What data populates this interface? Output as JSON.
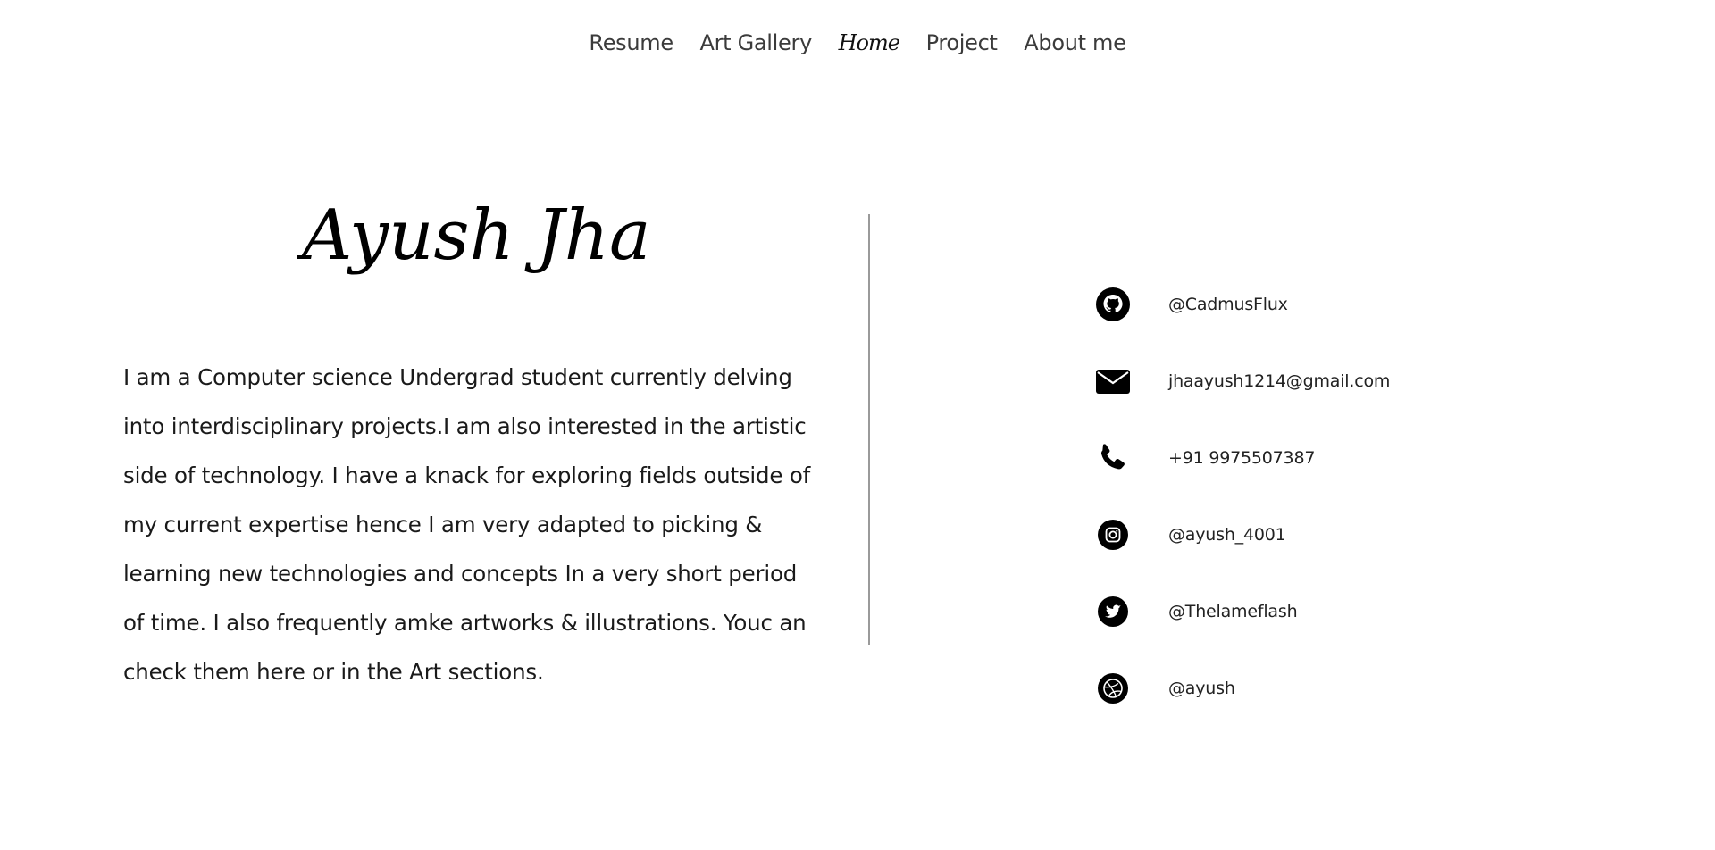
{
  "nav": {
    "items": [
      {
        "label": "Resume"
      },
      {
        "label": "Art Gallery"
      },
      {
        "label": "Home"
      },
      {
        "label": "Project"
      },
      {
        "label": "About me"
      }
    ],
    "active": "Home"
  },
  "hero": {
    "name": "Ayush Jha",
    "bio": "I am a Computer science Undergrad student currently delving into interdisciplinary projects.I am also interested in the artistic side of technology. I have a knack for exploring fields outside of my current expertise hence I am very adapted to picking & learning new technologies and concepts In a very short period of time. I also frequently amke artworks & illustrations. Youc an check them here or in the Art sections."
  },
  "contacts": [
    {
      "icon": "github-icon",
      "text": "@CadmusFlux"
    },
    {
      "icon": "mail-icon",
      "text": "jhaayush1214@gmail.com"
    },
    {
      "icon": "phone-icon",
      "text": "+91 9975507387"
    },
    {
      "icon": "instagram-icon",
      "text": "@ayush_4001"
    },
    {
      "icon": "twitter-icon",
      "text": "@Thelameflash"
    },
    {
      "icon": "dribbble-icon",
      "text": "@ayush"
    }
  ],
  "colors": {
    "background": "#ffffff",
    "text": "#111111",
    "nav_text": "#3b3b3b",
    "divider": "#9a9a9a"
  }
}
